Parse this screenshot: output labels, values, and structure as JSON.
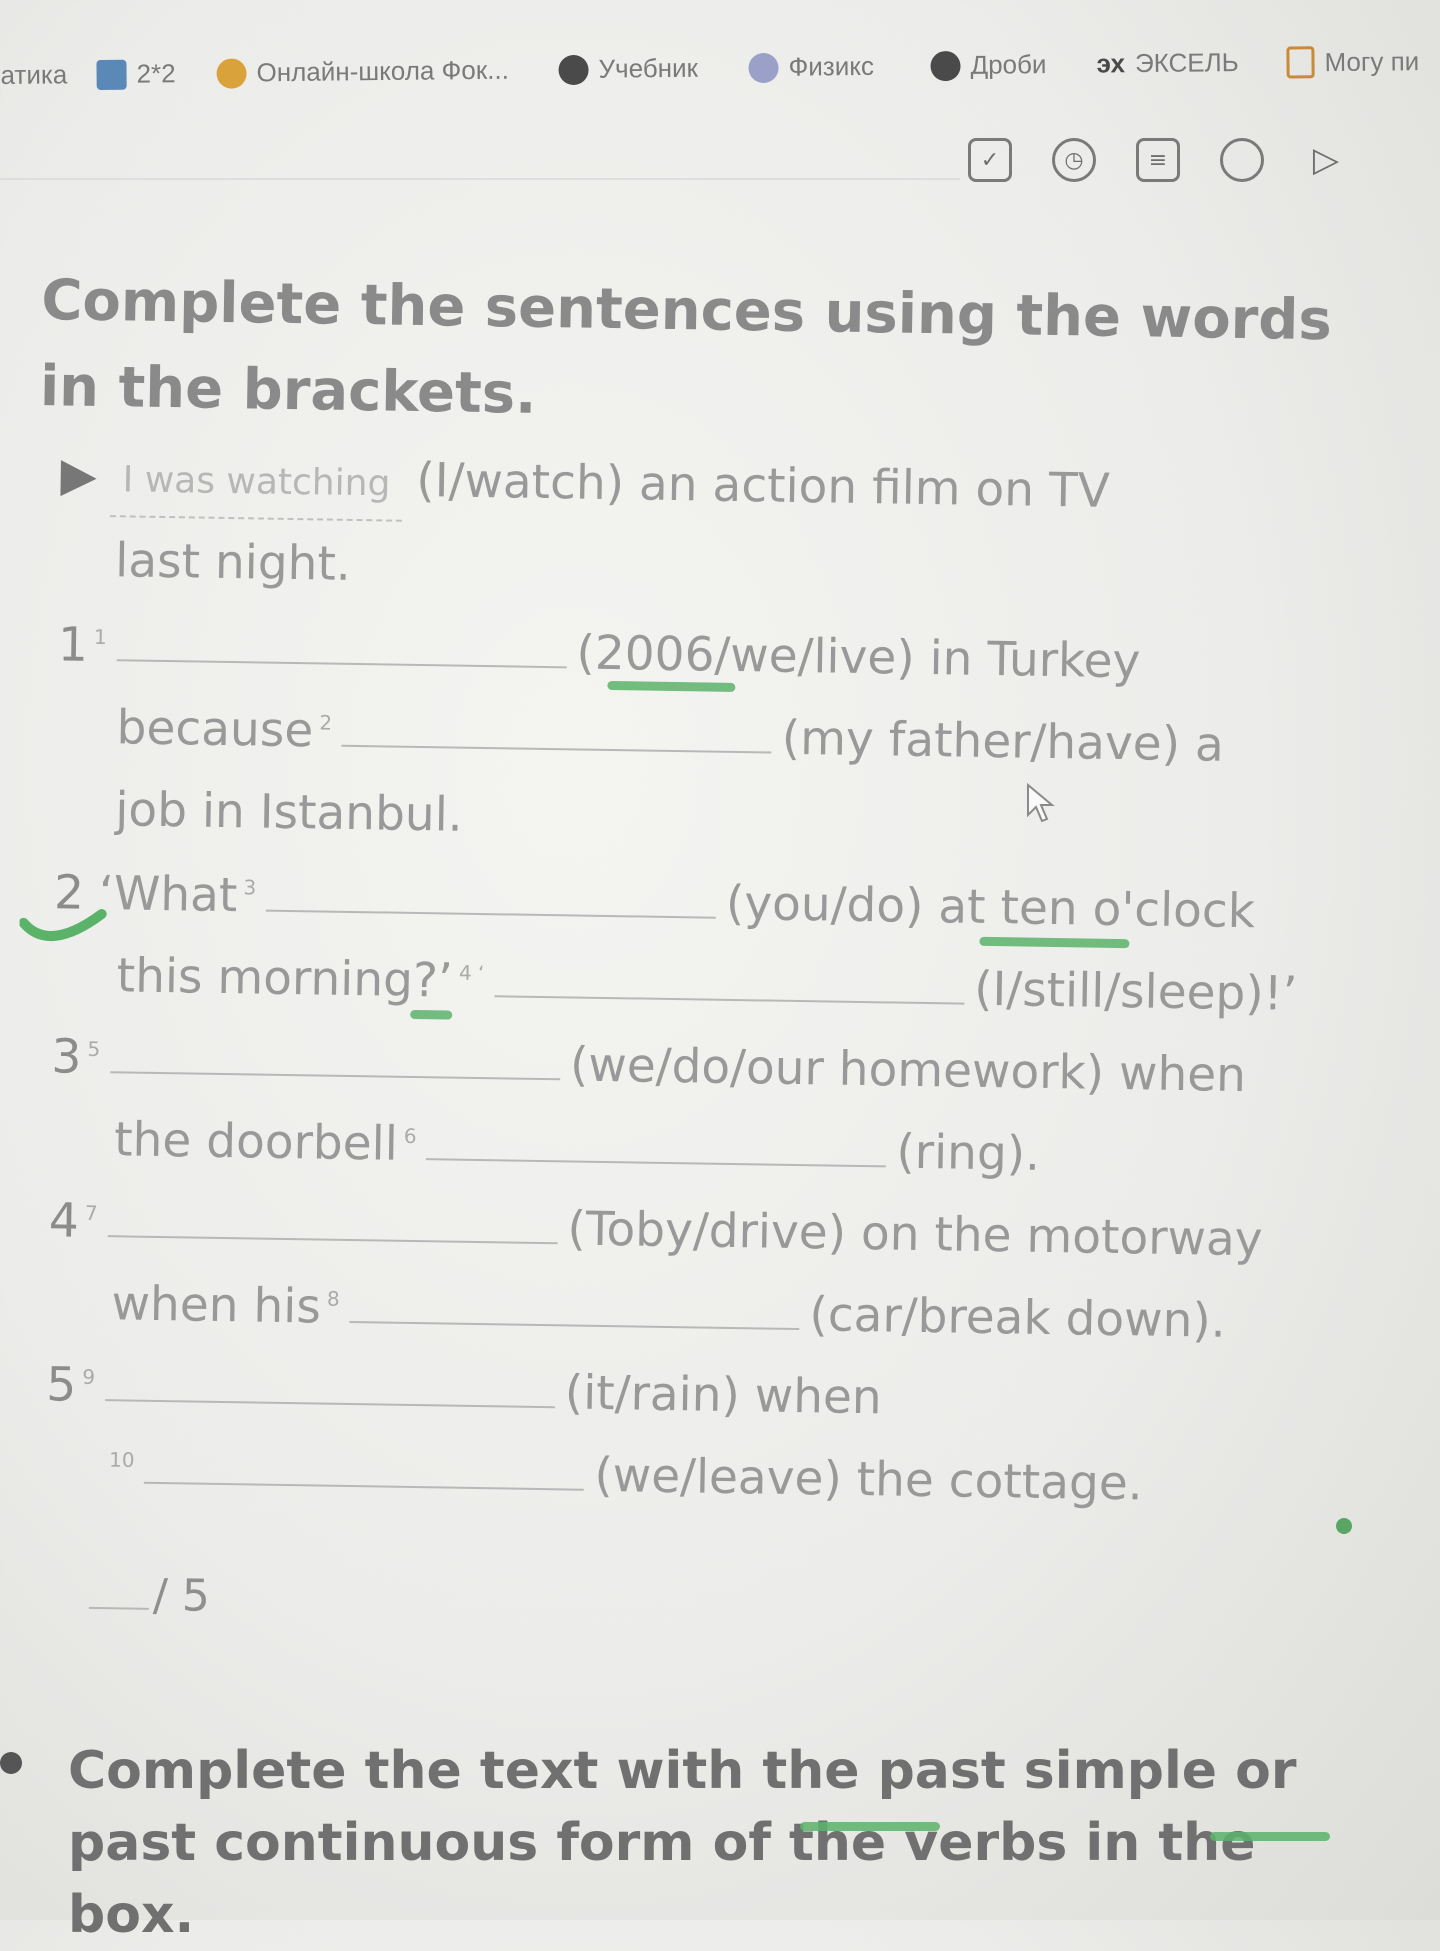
{
  "bookmarks": [
    {
      "label": "атика",
      "color": "#b9b9b9"
    },
    {
      "label": "2*2",
      "color": "#5a89b8"
    },
    {
      "label": "Онлайн-школа Фок...",
      "color": "#d9a23a"
    },
    {
      "label": "Учебник",
      "color": "#4a4a4a"
    },
    {
      "label": "Физикс",
      "color": "#9aa0c7"
    },
    {
      "label": "Дроби",
      "color": "#4a4a4a"
    },
    {
      "label": "ЭКСЕЛЬ",
      "prefix": "эх",
      "color": "#4a4a4a"
    },
    {
      "label": "Могу пи",
      "color": "#c98a3a"
    }
  ],
  "toolbar": {
    "icons": [
      "checkbox-icon",
      "timer-icon",
      "notes-icon",
      "comment-icon",
      "play-filter-icon"
    ]
  },
  "exercise": {
    "title": "Complete the sentences using the words in the brackets.",
    "example": {
      "answer": "I was watching",
      "hint": "(I/watch) an action film on TV",
      "continuation": "last night."
    },
    "items": [
      {
        "number": "1",
        "sup1": "1",
        "hint1": "(2006/we/live) in Turkey",
        "pre2": "because",
        "sup2": "2",
        "hint2": "(my father/have) a",
        "continuation": "job in Istanbul."
      },
      {
        "number": "2",
        "pre1": "‘What",
        "sup1": "3",
        "hint1": "(you/do) at ten o'clock",
        "pre2": "this morning?’",
        "sup2": "4 ‘",
        "hint2": "(I/still/sleep)!’"
      },
      {
        "number": "3",
        "sup1": "5",
        "hint1": "(we/do/our homework) when",
        "pre2": "the doorbell",
        "sup2": "6",
        "hint2": "(ring)."
      },
      {
        "number": "4",
        "sup1": "7",
        "hint1": "(Toby/drive) on the motorway",
        "pre2": "when his",
        "sup2": "8",
        "hint2": "(car/break down)."
      },
      {
        "number": "5",
        "sup1": "9",
        "hint1": "(it/rain) when",
        "sup2": "10",
        "hint2": "(we/leave) the cottage."
      }
    ],
    "score": "/ 5"
  },
  "next_exercise": {
    "title": "Complete the text with the past simple or past continuous form of the verbs in the box."
  },
  "colors": {
    "highlight": "#5bb36a"
  }
}
